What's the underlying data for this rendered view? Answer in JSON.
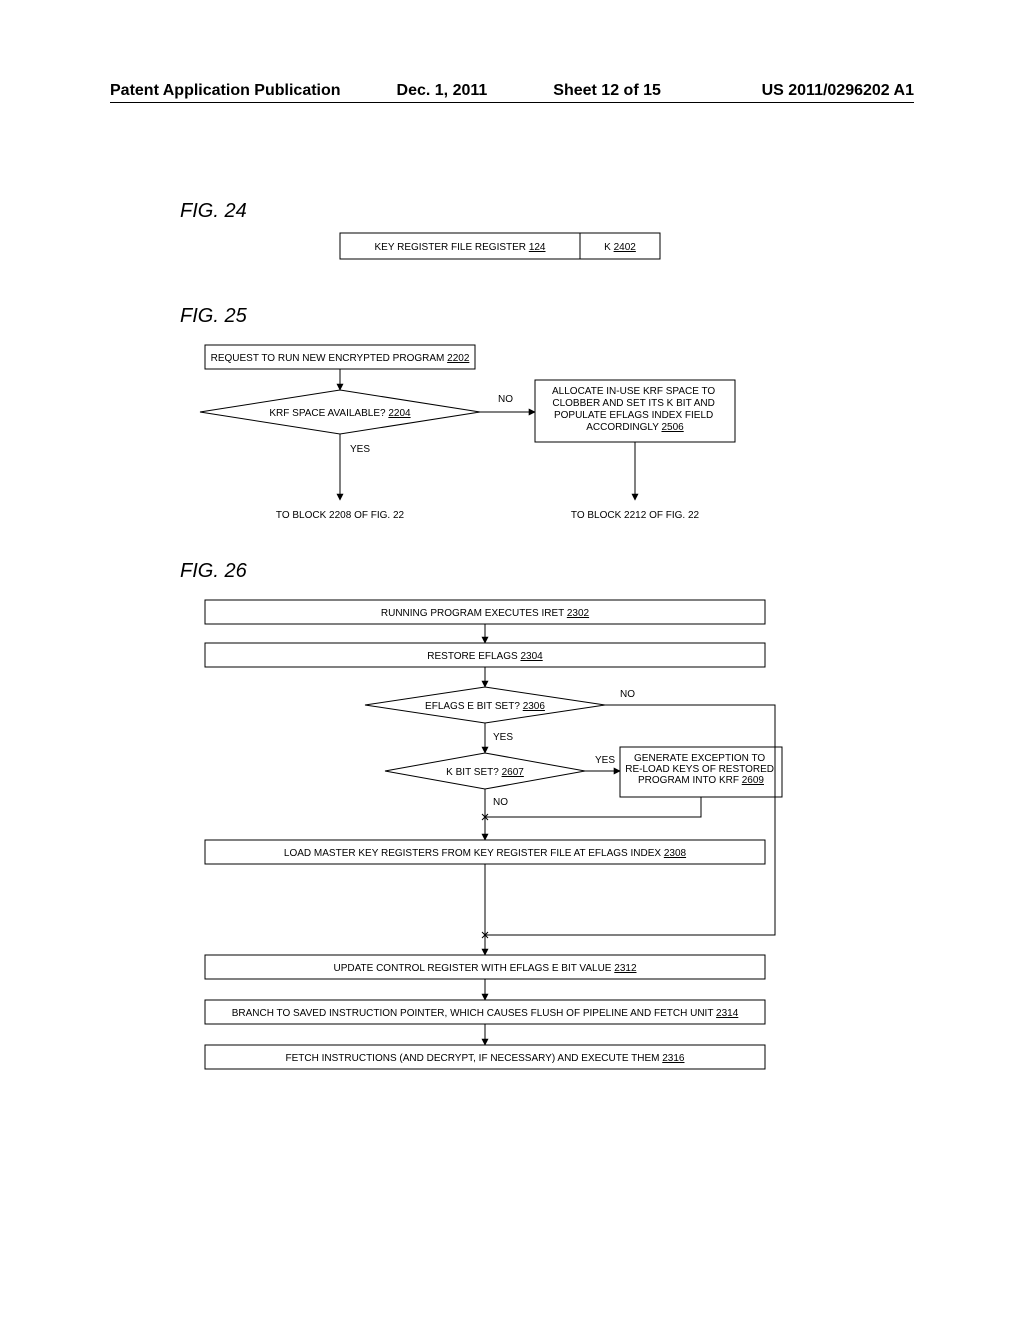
{
  "header": {
    "left": "Patent Application Publication",
    "date": "Dec. 1, 2011",
    "sheet": "Sheet 12 of 15",
    "pubnum": "US 2011/0296202 A1"
  },
  "fig24": {
    "label": "FIG. 24",
    "krf_box": "KEY REGISTER FILE REGISTER",
    "krf_ref": "124",
    "k_box": "K",
    "k_ref": "2402"
  },
  "fig25": {
    "label": "FIG. 25",
    "start": "REQUEST TO RUN NEW ENCRYPTED PROGRAM",
    "start_ref": "2202",
    "decision": "KRF SPACE AVAILABLE?",
    "decision_ref": "2204",
    "yes": "YES",
    "no": "NO",
    "right_box": "ALLOCATE  IN-USE KRF SPACE TO CLOBBER AND SET ITS K BIT AND POPULATE EFLAGS INDEX FIELD ACCORDINGLY",
    "right_box_ref": "2506",
    "to_left": "TO BLOCK 2208 OF FIG. 22",
    "to_right": "TO BLOCK 2212 OF FIG. 22"
  },
  "fig26": {
    "label": "FIG. 26",
    "b1": "RUNNING PROGRAM  EXECUTES IRET",
    "b1_ref": "2302",
    "b2": "RESTORE EFLAGS",
    "b2_ref": "2304",
    "d1": "EFLAGS E BIT SET?",
    "d1_ref": "2306",
    "d2": "K BIT SET?",
    "d2_ref": "2607",
    "rbox": "GENERATE EXCEPTION TO RE-LOAD KEYS OF RESTORED PROGRAM INTO KRF",
    "rbox_ref": "2609",
    "b3": "LOAD MASTER KEY REGISTERS FROM KEY REGISTER FILE AT EFLAGS INDEX",
    "b3_ref": "2308",
    "b4": "UPDATE CONTROL REGISTER WITH EFLAGS E BIT VALUE",
    "b4_ref": "2312",
    "b5": "BRANCH TO SAVED INSTRUCTION POINTER, WHICH CAUSES FLUSH OF PIPELINE AND FETCH UNIT",
    "b5_ref": "2314",
    "b6": "FETCH INSTRUCTIONS (AND DECRYPT, IF NECESSARY) AND EXECUTE THEM",
    "b6_ref": "2316",
    "yes": "YES",
    "no": "NO"
  }
}
